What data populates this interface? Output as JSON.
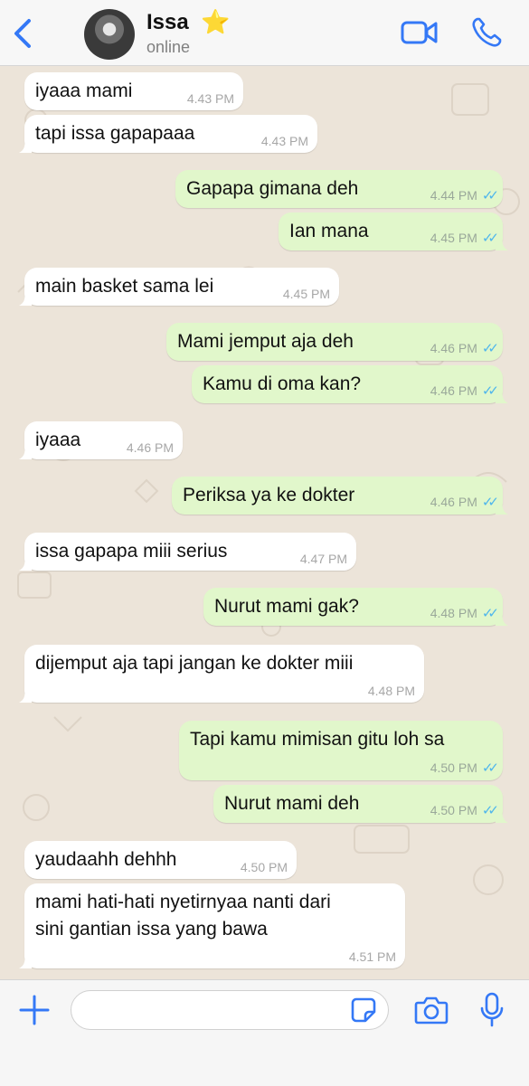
{
  "header": {
    "contact_name": "Issa",
    "contact_emoji": "⭐",
    "status": "online",
    "accent_color": "#3478f6"
  },
  "messages": [
    {
      "dir": "in",
      "text": "iyaaa mami",
      "time": "4.43 PM"
    },
    {
      "dir": "in",
      "text": "tapi issa gapapaaa",
      "time": "4.43 PM"
    },
    {
      "dir": "out",
      "text": "Gapapa gimana deh",
      "time": "4.44 PM"
    },
    {
      "dir": "out",
      "text": "Ian mana",
      "time": "4.45 PM"
    },
    {
      "dir": "in",
      "text": "main basket sama lei",
      "time": "4.45 PM"
    },
    {
      "dir": "out",
      "text": "Mami jemput aja deh",
      "time": "4.46 PM"
    },
    {
      "dir": "out",
      "text": "Kamu di oma kan?",
      "time": "4.46 PM"
    },
    {
      "dir": "in",
      "text": "iyaaa",
      "time": "4.46 PM"
    },
    {
      "dir": "out",
      "text": "Periksa ya ke dokter",
      "time": "4.46 PM"
    },
    {
      "dir": "in",
      "text": "issa gapapa miii serius",
      "time": "4.47 PM"
    },
    {
      "dir": "out",
      "text": "Nurut mami gak?",
      "time": "4.48 PM"
    },
    {
      "dir": "in",
      "text": "dijemput aja tapi jangan ke dokter miii",
      "time": "4.48 PM"
    },
    {
      "dir": "out",
      "text": "Tapi kamu mimisan gitu loh sa",
      "time": "4.50 PM"
    },
    {
      "dir": "out",
      "text": "Nurut mami deh",
      "time": "4.50 PM"
    },
    {
      "dir": "in",
      "text": "yaudaahh dehhh",
      "time": "4.50 PM"
    },
    {
      "dir": "in",
      "text_line1": "mami hati-hati nyetirnyaa nanti dari",
      "text_line2": "sini gantian issa yang bawa",
      "time": "4.51 PM"
    }
  ],
  "composer": {
    "placeholder": "",
    "icons": [
      "plus-icon",
      "sticker-icon",
      "camera-icon",
      "microphone-icon"
    ]
  },
  "colors": {
    "incoming_bubble": "#ffffff",
    "outgoing_bubble": "#e1f7cb",
    "read_ticks": "#4fb6ec",
    "chat_background": "#ece4d9"
  }
}
